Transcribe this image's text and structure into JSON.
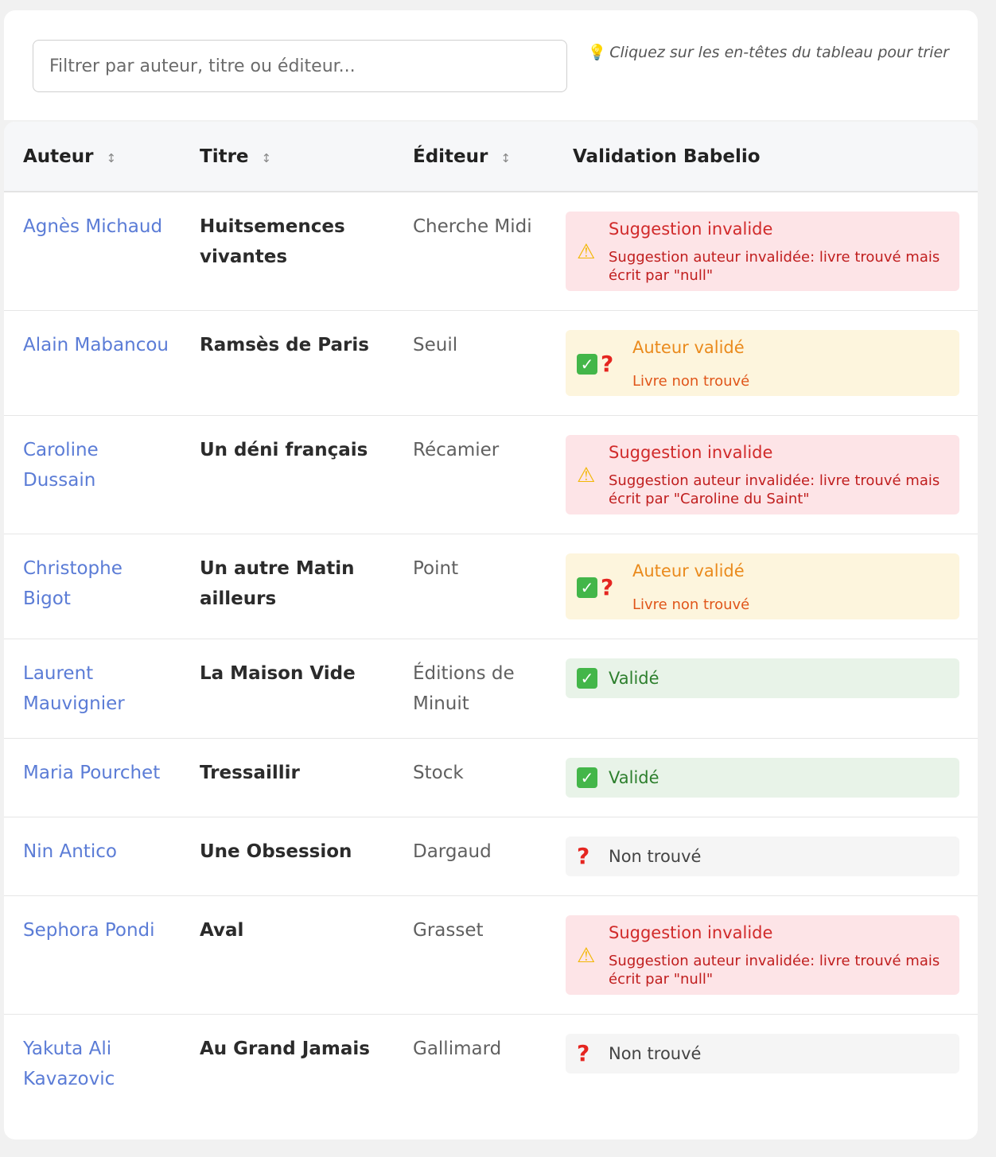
{
  "filter": {
    "placeholder": "Filtrer par auteur, titre ou éditeur..."
  },
  "hint": {
    "icon": "💡",
    "text": "Cliquez sur les en-têtes du tableau pour trier"
  },
  "table": {
    "headers": {
      "author": "Auteur",
      "title": "Titre",
      "editor": "Éditeur",
      "validation": "Validation Babelio",
      "sort_icon": "↕"
    },
    "rows": [
      {
        "author": "Agnès Michaud",
        "title": "Huitsemences vivantes",
        "editor": "Cherche Midi",
        "status": "invalid",
        "line1": "Suggestion invalide",
        "line2": "Suggestion auteur invalidée: livre trouvé mais écrit par \"null\""
      },
      {
        "author": "Alain Mabancou",
        "title": "Ramsès de Paris",
        "editor": "Seuil",
        "status": "author",
        "line1": "Auteur validé",
        "line2": "Livre non trouvé"
      },
      {
        "author": "Caroline Dussain",
        "title": "Un déni français",
        "editor": "Récamier",
        "status": "invalid",
        "line1": "Suggestion invalide",
        "line2": "Suggestion auteur invalidée: livre trouvé mais écrit par \"Caroline du Saint\""
      },
      {
        "author": "Christophe Bigot",
        "title": "Un autre Matin ailleurs",
        "editor": "Point",
        "status": "author",
        "line1": "Auteur validé",
        "line2": "Livre non trouvé"
      },
      {
        "author": "Laurent Mauvignier",
        "title": "La Maison Vide",
        "editor": "Éditions de Minuit",
        "status": "valid",
        "line1": "Validé"
      },
      {
        "author": "Maria Pourchet",
        "title": "Tressaillir",
        "editor": "Stock",
        "status": "valid",
        "line1": "Validé"
      },
      {
        "author": "Nin Antico",
        "title": "Une Obsession",
        "editor": "Dargaud",
        "status": "none",
        "line1": "Non trouvé"
      },
      {
        "author": "Sephora Pondi",
        "title": "Aval",
        "editor": "Grasset",
        "status": "invalid",
        "line1": "Suggestion invalide",
        "line2": "Suggestion auteur invalidée: livre trouvé mais écrit par \"null\""
      },
      {
        "author": "Yakuta Ali Kavazovic",
        "title": "Au Grand Jamais",
        "editor": "Gallimard",
        "status": "none",
        "line1": "Non trouvé"
      }
    ]
  },
  "colors": {
    "author_link": "#5b7cd6",
    "invalid_bg": "#fde4e7",
    "author_bg": "#fdf5dd",
    "valid_bg": "#e8f3e8",
    "none_bg": "#f5f5f5"
  }
}
